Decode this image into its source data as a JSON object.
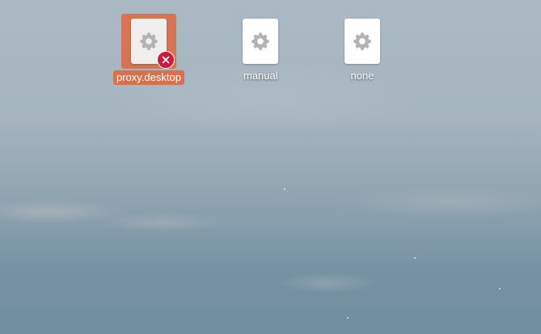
{
  "desktop": {
    "icons": [
      {
        "label": "proxy.desktop",
        "selected": true,
        "emblem": "unreadable-x-icon",
        "icon": "gear-icon"
      },
      {
        "label": "manual",
        "selected": false,
        "icon": "gear-icon"
      },
      {
        "label": "none",
        "selected": false,
        "icon": "gear-icon"
      }
    ],
    "colors": {
      "selection": "#d8704c",
      "emblem": "#c81e3c",
      "gear": "#b3b3b3"
    }
  }
}
